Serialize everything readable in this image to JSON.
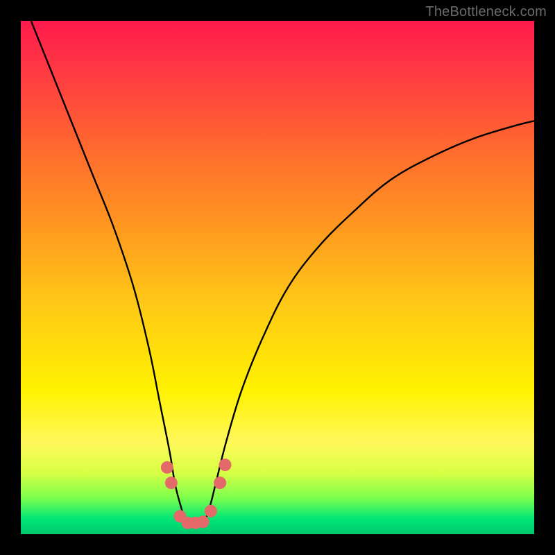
{
  "watermark": "TheBottleneck.com",
  "colors": {
    "frame": "#000000",
    "curve_stroke": "#000000",
    "marker_fill": "#e46a6a",
    "marker_stroke": "#d85a5a",
    "gradient_stops": [
      {
        "pct": 0,
        "color": "#ff1a4d"
      },
      {
        "pct": 12,
        "color": "#ff4040"
      },
      {
        "pct": 25,
        "color": "#ff6a2e"
      },
      {
        "pct": 40,
        "color": "#ff9820"
      },
      {
        "pct": 55,
        "color": "#ffc816"
      },
      {
        "pct": 72,
        "color": "#fff200"
      },
      {
        "pct": 82,
        "color": "#fff85a"
      },
      {
        "pct": 88,
        "color": "#d8ff44"
      },
      {
        "pct": 93,
        "color": "#7bff4d"
      },
      {
        "pct": 97,
        "color": "#00e676"
      },
      {
        "pct": 100,
        "color": "#00c86e"
      }
    ]
  },
  "chart_data": {
    "type": "line",
    "title": "",
    "xlabel": "",
    "ylabel": "",
    "xlim": [
      0,
      100
    ],
    "ylim": [
      0,
      100
    ],
    "grid": false,
    "legend": false,
    "series": [
      {
        "name": "bottleneck-curve",
        "x": [
          2,
          6,
          10,
          14,
          18,
          22,
          25,
          27,
          29,
          30,
          31,
          32,
          33,
          34,
          35,
          36,
          37,
          38,
          40,
          43,
          47,
          52,
          58,
          65,
          72,
          80,
          88,
          96,
          100
        ],
        "y": [
          100,
          90,
          80,
          70,
          60,
          48,
          36,
          26,
          16,
          10,
          6,
          3,
          2,
          2,
          2,
          3,
          6,
          10,
          18,
          28,
          38,
          48,
          56,
          63,
          69,
          73.5,
          77,
          79.5,
          80.5
        ]
      }
    ],
    "markers": [
      {
        "x": 28.5,
        "y": 13
      },
      {
        "x": 29.3,
        "y": 10
      },
      {
        "x": 31.0,
        "y": 3.5
      },
      {
        "x": 32.5,
        "y": 2.2
      },
      {
        "x": 34.0,
        "y": 2.2
      },
      {
        "x": 35.5,
        "y": 2.4
      },
      {
        "x": 37.0,
        "y": 4.5
      },
      {
        "x": 38.8,
        "y": 10
      },
      {
        "x": 39.8,
        "y": 13.5
      }
    ]
  }
}
